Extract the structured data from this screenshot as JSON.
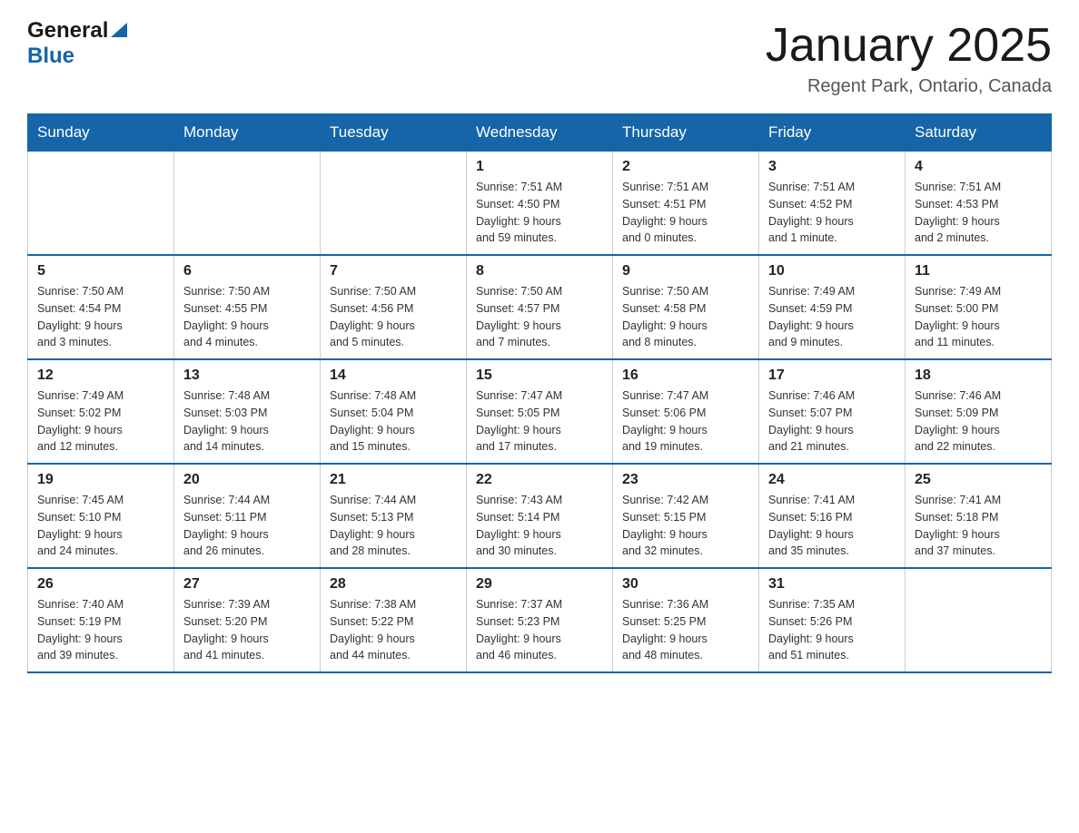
{
  "header": {
    "logo": {
      "general": "General",
      "blue": "Blue",
      "triangle": "▶"
    },
    "title": "January 2025",
    "location": "Regent Park, Ontario, Canada"
  },
  "weekdays": [
    "Sunday",
    "Monday",
    "Tuesday",
    "Wednesday",
    "Thursday",
    "Friday",
    "Saturday"
  ],
  "weeks": [
    [
      {
        "day": "",
        "info": ""
      },
      {
        "day": "",
        "info": ""
      },
      {
        "day": "",
        "info": ""
      },
      {
        "day": "1",
        "info": "Sunrise: 7:51 AM\nSunset: 4:50 PM\nDaylight: 9 hours\nand 59 minutes."
      },
      {
        "day": "2",
        "info": "Sunrise: 7:51 AM\nSunset: 4:51 PM\nDaylight: 9 hours\nand 0 minutes."
      },
      {
        "day": "3",
        "info": "Sunrise: 7:51 AM\nSunset: 4:52 PM\nDaylight: 9 hours\nand 1 minute."
      },
      {
        "day": "4",
        "info": "Sunrise: 7:51 AM\nSunset: 4:53 PM\nDaylight: 9 hours\nand 2 minutes."
      }
    ],
    [
      {
        "day": "5",
        "info": "Sunrise: 7:50 AM\nSunset: 4:54 PM\nDaylight: 9 hours\nand 3 minutes."
      },
      {
        "day": "6",
        "info": "Sunrise: 7:50 AM\nSunset: 4:55 PM\nDaylight: 9 hours\nand 4 minutes."
      },
      {
        "day": "7",
        "info": "Sunrise: 7:50 AM\nSunset: 4:56 PM\nDaylight: 9 hours\nand 5 minutes."
      },
      {
        "day": "8",
        "info": "Sunrise: 7:50 AM\nSunset: 4:57 PM\nDaylight: 9 hours\nand 7 minutes."
      },
      {
        "day": "9",
        "info": "Sunrise: 7:50 AM\nSunset: 4:58 PM\nDaylight: 9 hours\nand 8 minutes."
      },
      {
        "day": "10",
        "info": "Sunrise: 7:49 AM\nSunset: 4:59 PM\nDaylight: 9 hours\nand 9 minutes."
      },
      {
        "day": "11",
        "info": "Sunrise: 7:49 AM\nSunset: 5:00 PM\nDaylight: 9 hours\nand 11 minutes."
      }
    ],
    [
      {
        "day": "12",
        "info": "Sunrise: 7:49 AM\nSunset: 5:02 PM\nDaylight: 9 hours\nand 12 minutes."
      },
      {
        "day": "13",
        "info": "Sunrise: 7:48 AM\nSunset: 5:03 PM\nDaylight: 9 hours\nand 14 minutes."
      },
      {
        "day": "14",
        "info": "Sunrise: 7:48 AM\nSunset: 5:04 PM\nDaylight: 9 hours\nand 15 minutes."
      },
      {
        "day": "15",
        "info": "Sunrise: 7:47 AM\nSunset: 5:05 PM\nDaylight: 9 hours\nand 17 minutes."
      },
      {
        "day": "16",
        "info": "Sunrise: 7:47 AM\nSunset: 5:06 PM\nDaylight: 9 hours\nand 19 minutes."
      },
      {
        "day": "17",
        "info": "Sunrise: 7:46 AM\nSunset: 5:07 PM\nDaylight: 9 hours\nand 21 minutes."
      },
      {
        "day": "18",
        "info": "Sunrise: 7:46 AM\nSunset: 5:09 PM\nDaylight: 9 hours\nand 22 minutes."
      }
    ],
    [
      {
        "day": "19",
        "info": "Sunrise: 7:45 AM\nSunset: 5:10 PM\nDaylight: 9 hours\nand 24 minutes."
      },
      {
        "day": "20",
        "info": "Sunrise: 7:44 AM\nSunset: 5:11 PM\nDaylight: 9 hours\nand 26 minutes."
      },
      {
        "day": "21",
        "info": "Sunrise: 7:44 AM\nSunset: 5:13 PM\nDaylight: 9 hours\nand 28 minutes."
      },
      {
        "day": "22",
        "info": "Sunrise: 7:43 AM\nSunset: 5:14 PM\nDaylight: 9 hours\nand 30 minutes."
      },
      {
        "day": "23",
        "info": "Sunrise: 7:42 AM\nSunset: 5:15 PM\nDaylight: 9 hours\nand 32 minutes."
      },
      {
        "day": "24",
        "info": "Sunrise: 7:41 AM\nSunset: 5:16 PM\nDaylight: 9 hours\nand 35 minutes."
      },
      {
        "day": "25",
        "info": "Sunrise: 7:41 AM\nSunset: 5:18 PM\nDaylight: 9 hours\nand 37 minutes."
      }
    ],
    [
      {
        "day": "26",
        "info": "Sunrise: 7:40 AM\nSunset: 5:19 PM\nDaylight: 9 hours\nand 39 minutes."
      },
      {
        "day": "27",
        "info": "Sunrise: 7:39 AM\nSunset: 5:20 PM\nDaylight: 9 hours\nand 41 minutes."
      },
      {
        "day": "28",
        "info": "Sunrise: 7:38 AM\nSunset: 5:22 PM\nDaylight: 9 hours\nand 44 minutes."
      },
      {
        "day": "29",
        "info": "Sunrise: 7:37 AM\nSunset: 5:23 PM\nDaylight: 9 hours\nand 46 minutes."
      },
      {
        "day": "30",
        "info": "Sunrise: 7:36 AM\nSunset: 5:25 PM\nDaylight: 9 hours\nand 48 minutes."
      },
      {
        "day": "31",
        "info": "Sunrise: 7:35 AM\nSunset: 5:26 PM\nDaylight: 9 hours\nand 51 minutes."
      },
      {
        "day": "",
        "info": ""
      }
    ]
  ]
}
